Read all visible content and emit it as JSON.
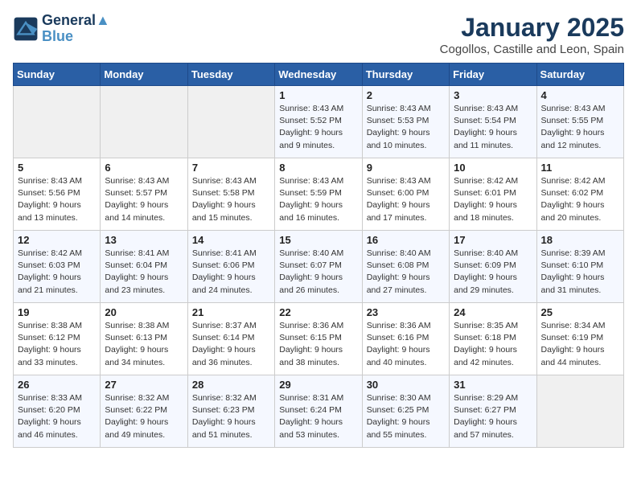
{
  "logo": {
    "line1": "General",
    "line2": "Blue"
  },
  "title": "January 2025",
  "subtitle": "Cogollos, Castille and Leon, Spain",
  "weekdays": [
    "Sunday",
    "Monday",
    "Tuesday",
    "Wednesday",
    "Thursday",
    "Friday",
    "Saturday"
  ],
  "weeks": [
    [
      {
        "day": "",
        "info": ""
      },
      {
        "day": "",
        "info": ""
      },
      {
        "day": "",
        "info": ""
      },
      {
        "day": "1",
        "info": "Sunrise: 8:43 AM\nSunset: 5:52 PM\nDaylight: 9 hours\nand 9 minutes."
      },
      {
        "day": "2",
        "info": "Sunrise: 8:43 AM\nSunset: 5:53 PM\nDaylight: 9 hours\nand 10 minutes."
      },
      {
        "day": "3",
        "info": "Sunrise: 8:43 AM\nSunset: 5:54 PM\nDaylight: 9 hours\nand 11 minutes."
      },
      {
        "day": "4",
        "info": "Sunrise: 8:43 AM\nSunset: 5:55 PM\nDaylight: 9 hours\nand 12 minutes."
      }
    ],
    [
      {
        "day": "5",
        "info": "Sunrise: 8:43 AM\nSunset: 5:56 PM\nDaylight: 9 hours\nand 13 minutes."
      },
      {
        "day": "6",
        "info": "Sunrise: 8:43 AM\nSunset: 5:57 PM\nDaylight: 9 hours\nand 14 minutes."
      },
      {
        "day": "7",
        "info": "Sunrise: 8:43 AM\nSunset: 5:58 PM\nDaylight: 9 hours\nand 15 minutes."
      },
      {
        "day": "8",
        "info": "Sunrise: 8:43 AM\nSunset: 5:59 PM\nDaylight: 9 hours\nand 16 minutes."
      },
      {
        "day": "9",
        "info": "Sunrise: 8:43 AM\nSunset: 6:00 PM\nDaylight: 9 hours\nand 17 minutes."
      },
      {
        "day": "10",
        "info": "Sunrise: 8:42 AM\nSunset: 6:01 PM\nDaylight: 9 hours\nand 18 minutes."
      },
      {
        "day": "11",
        "info": "Sunrise: 8:42 AM\nSunset: 6:02 PM\nDaylight: 9 hours\nand 20 minutes."
      }
    ],
    [
      {
        "day": "12",
        "info": "Sunrise: 8:42 AM\nSunset: 6:03 PM\nDaylight: 9 hours\nand 21 minutes."
      },
      {
        "day": "13",
        "info": "Sunrise: 8:41 AM\nSunset: 6:04 PM\nDaylight: 9 hours\nand 23 minutes."
      },
      {
        "day": "14",
        "info": "Sunrise: 8:41 AM\nSunset: 6:06 PM\nDaylight: 9 hours\nand 24 minutes."
      },
      {
        "day": "15",
        "info": "Sunrise: 8:40 AM\nSunset: 6:07 PM\nDaylight: 9 hours\nand 26 minutes."
      },
      {
        "day": "16",
        "info": "Sunrise: 8:40 AM\nSunset: 6:08 PM\nDaylight: 9 hours\nand 27 minutes."
      },
      {
        "day": "17",
        "info": "Sunrise: 8:40 AM\nSunset: 6:09 PM\nDaylight: 9 hours\nand 29 minutes."
      },
      {
        "day": "18",
        "info": "Sunrise: 8:39 AM\nSunset: 6:10 PM\nDaylight: 9 hours\nand 31 minutes."
      }
    ],
    [
      {
        "day": "19",
        "info": "Sunrise: 8:38 AM\nSunset: 6:12 PM\nDaylight: 9 hours\nand 33 minutes."
      },
      {
        "day": "20",
        "info": "Sunrise: 8:38 AM\nSunset: 6:13 PM\nDaylight: 9 hours\nand 34 minutes."
      },
      {
        "day": "21",
        "info": "Sunrise: 8:37 AM\nSunset: 6:14 PM\nDaylight: 9 hours\nand 36 minutes."
      },
      {
        "day": "22",
        "info": "Sunrise: 8:36 AM\nSunset: 6:15 PM\nDaylight: 9 hours\nand 38 minutes."
      },
      {
        "day": "23",
        "info": "Sunrise: 8:36 AM\nSunset: 6:16 PM\nDaylight: 9 hours\nand 40 minutes."
      },
      {
        "day": "24",
        "info": "Sunrise: 8:35 AM\nSunset: 6:18 PM\nDaylight: 9 hours\nand 42 minutes."
      },
      {
        "day": "25",
        "info": "Sunrise: 8:34 AM\nSunset: 6:19 PM\nDaylight: 9 hours\nand 44 minutes."
      }
    ],
    [
      {
        "day": "26",
        "info": "Sunrise: 8:33 AM\nSunset: 6:20 PM\nDaylight: 9 hours\nand 46 minutes."
      },
      {
        "day": "27",
        "info": "Sunrise: 8:32 AM\nSunset: 6:22 PM\nDaylight: 9 hours\nand 49 minutes."
      },
      {
        "day": "28",
        "info": "Sunrise: 8:32 AM\nSunset: 6:23 PM\nDaylight: 9 hours\nand 51 minutes."
      },
      {
        "day": "29",
        "info": "Sunrise: 8:31 AM\nSunset: 6:24 PM\nDaylight: 9 hours\nand 53 minutes."
      },
      {
        "day": "30",
        "info": "Sunrise: 8:30 AM\nSunset: 6:25 PM\nDaylight: 9 hours\nand 55 minutes."
      },
      {
        "day": "31",
        "info": "Sunrise: 8:29 AM\nSunset: 6:27 PM\nDaylight: 9 hours\nand 57 minutes."
      },
      {
        "day": "",
        "info": ""
      }
    ]
  ]
}
